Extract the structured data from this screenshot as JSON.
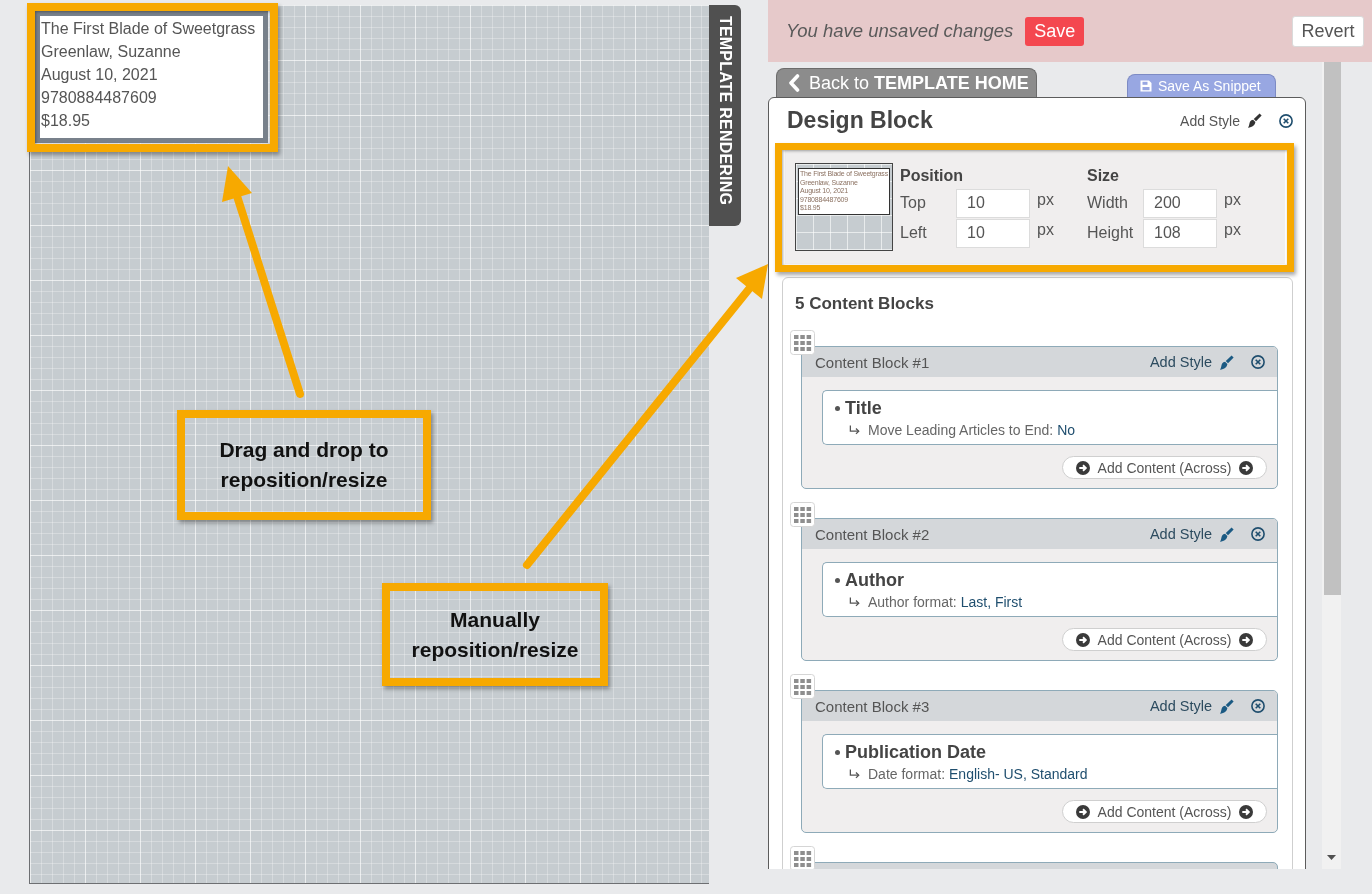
{
  "canvas": {
    "tab_label": "TEMPLATE RENDERING",
    "block_lines": [
      "The First Blade of Sweetgrass",
      "Greenlaw, Suzanne",
      "August 10, 2021",
      "9780884487609",
      "$18.95"
    ]
  },
  "callouts": [
    {
      "text": "Drag and drop to reposition/resize"
    },
    {
      "text": "Manually reposition/resize"
    }
  ],
  "unsaved_bar": {
    "message": "You have unsaved changes",
    "save_label": "Save",
    "revert_label": "Revert"
  },
  "back_tab": {
    "label": "Back to **TEMPLATE HOME**"
  },
  "snippet_button": {
    "label": "Save As Snippet"
  },
  "design_block": {
    "title": "Design Block",
    "add_style": "Add Style",
    "thumbnail_lines": [
      "The First Blade of Sweetgrass",
      "Greenlaw, Suzanne",
      "August 10, 2021",
      "9780884487609",
      "$18.95"
    ],
    "groups": [
      {
        "heading": "Position",
        "fields": [
          {
            "label": "Top",
            "value": "10",
            "unit": "px"
          },
          {
            "label": "Left",
            "value": "10",
            "unit": "px"
          }
        ]
      },
      {
        "heading": "Size",
        "fields": [
          {
            "label": "Width",
            "value": "200",
            "unit": "px"
          },
          {
            "label": "Height",
            "value": "108",
            "unit": "px"
          }
        ]
      }
    ]
  },
  "content_blocks": {
    "heading": "5 Content Blocks",
    "blocks": [
      {
        "title": "Content Block #1",
        "add_style": "Add Style",
        "item": {
          "name": "Title",
          "option_label": "Move Leading Articles to End:",
          "option_value": "No"
        },
        "add_button": "Add Content (Across)"
      },
      {
        "title": "Content Block #2",
        "add_style": "Add Style",
        "item": {
          "name": "Author",
          "option_label": "Author format:",
          "option_value": "Last, First"
        },
        "add_button": "Add Content (Across)"
      },
      {
        "title": "Content Block #3",
        "add_style": "Add Style",
        "item": {
          "name": "Publication Date",
          "option_label": "Date format:",
          "option_value": "English- US, Standard"
        },
        "add_button": "Add Content (Across)"
      }
    ],
    "more_below": true
  }
}
